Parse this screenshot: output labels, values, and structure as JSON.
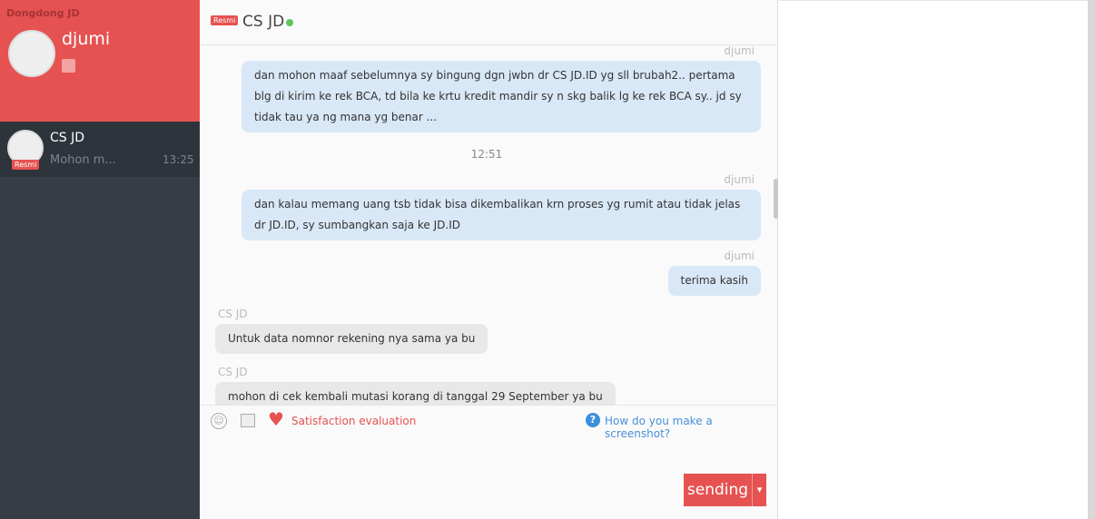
{
  "sidebar": {
    "app_name": "Dongdong JD",
    "user_name": "djumi",
    "conversations": [
      {
        "name": "CS JD",
        "badge": "Resmi",
        "preview": "Mohon m...",
        "time": "13:25"
      }
    ]
  },
  "header": {
    "badge": "Resmi",
    "title": "CS JD",
    "status_color": "#5cc85c"
  },
  "messages": [
    {
      "sender": "djumi",
      "text": "dan mohon maaf sebelumnya sy bingung dgn jwbn dr CS JD.ID yg sll brubah2.. pertama blg di kirim ke rek BCA, td bila ke krtu kredit mandir sy n skg balik lg ke rek BCA sy.. jd sy tidak tau ya ng mana yg benar ..."
    },
    {
      "time": "12:51"
    },
    {
      "sender": "djumi",
      "text": "dan kalau memang uang tsb tidak bisa dikembalikan krn proses yg rumit atau tidak jelas dr JD.ID, sy sumbangkan saja ke JD.ID"
    },
    {
      "sender": "djumi",
      "text": "terima kasih"
    },
    {
      "sender": "CS JD",
      "text": "Untuk data nomnor rekening nya sama ya bu"
    },
    {
      "sender": "CS JD",
      "text": "mohon di cek kembali mutasi korang di tanggal 29 September ya bu"
    }
  ],
  "toolbar": {
    "satisfaction": "Satisfaction evaluation",
    "help": "How do you make a screenshot?"
  },
  "send": {
    "label": "sending",
    "dropdown": "▾"
  },
  "colors": {
    "accent": "#e65252",
    "link": "#4a90d9"
  }
}
